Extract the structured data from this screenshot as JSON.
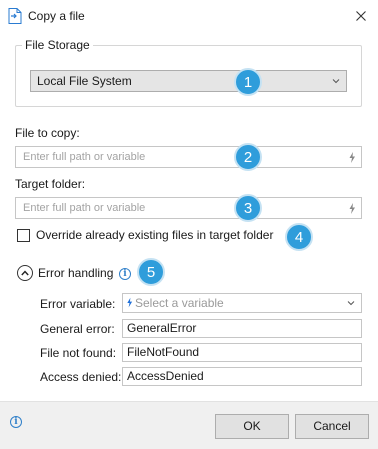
{
  "window": {
    "title": "Copy a file"
  },
  "file_storage": {
    "legend": "File Storage",
    "selected": "Local File System"
  },
  "file_to_copy": {
    "label": "File to copy:",
    "placeholder": "Enter full path or variable"
  },
  "target_folder": {
    "label": "Target folder:",
    "placeholder": "Enter full path or variable"
  },
  "override": {
    "label": "Override already existing files in target folder",
    "checked": false
  },
  "error_handling": {
    "label": "Error handling",
    "error_variable": {
      "label": "Error variable:",
      "placeholder": "Select a variable"
    },
    "general_error": {
      "label": "General error:",
      "value": "GeneralError"
    },
    "file_not_found": {
      "label": "File not found:",
      "value": "FileNotFound"
    },
    "access_denied": {
      "label": "Access denied:",
      "value": "AccessDenied"
    }
  },
  "badges": [
    "1",
    "2",
    "3",
    "4",
    "5"
  ],
  "footer": {
    "ok_label": "OK",
    "cancel_label": "Cancel"
  },
  "colors": {
    "badge": "#2f9ddb",
    "info": "#2f7fc9",
    "variable_icon": "#1e6fd9"
  }
}
